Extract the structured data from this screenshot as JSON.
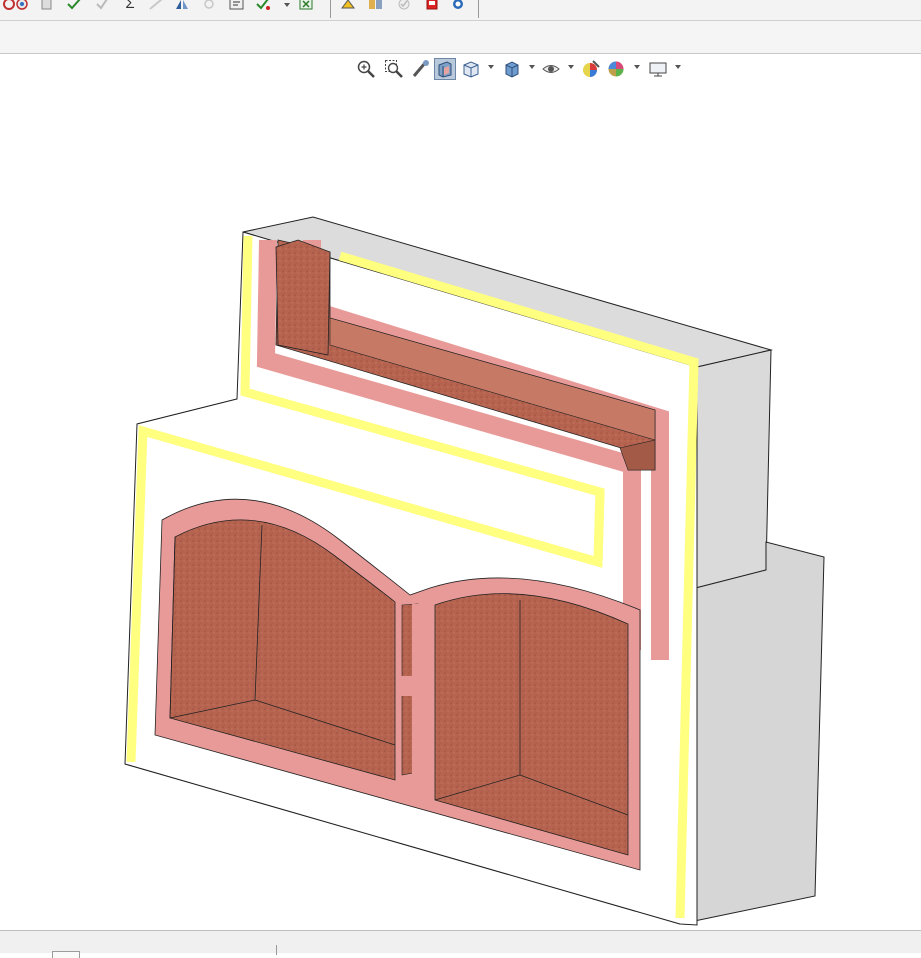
{
  "app": {
    "type": "CAD part editor",
    "accent_color": "#6d86a6"
  },
  "command_toolbar": {
    "icons": [
      "magnet-icon",
      "rebuild-icon",
      "check-document-icon",
      "verify-icon",
      "sum-icon",
      "measure-icon",
      "mirror-icon",
      "sketch-fillet-icon",
      "help-doc-icon",
      "evaluate-icon",
      "dropdown-arrow",
      "spreadsheet-x-icon",
      "heal-icon",
      "compare-icon",
      "approve-icon",
      "pdf-icon",
      "sync-icon"
    ],
    "sum_glyph": "Σ"
  },
  "view_toolbar": {
    "icons": [
      "zoom-to-fit-icon",
      "zoom-area-icon",
      "previous-view-icon",
      "section-view-icon",
      "view-orientation-icon",
      "display-style-icon",
      "hide-show-icon",
      "edit-appearance-icon",
      "apply-scene-icon",
      "view-settings-icon"
    ],
    "active": "section-view-icon"
  },
  "model": {
    "colors": {
      "outer_face": "#d9d9d9",
      "outer_face_light": "#eeeeee",
      "section_white": "#ffffff",
      "section_yellow": "#ffff80",
      "section_pink": "#e89a98",
      "section_brick": "#b66450"
    }
  }
}
